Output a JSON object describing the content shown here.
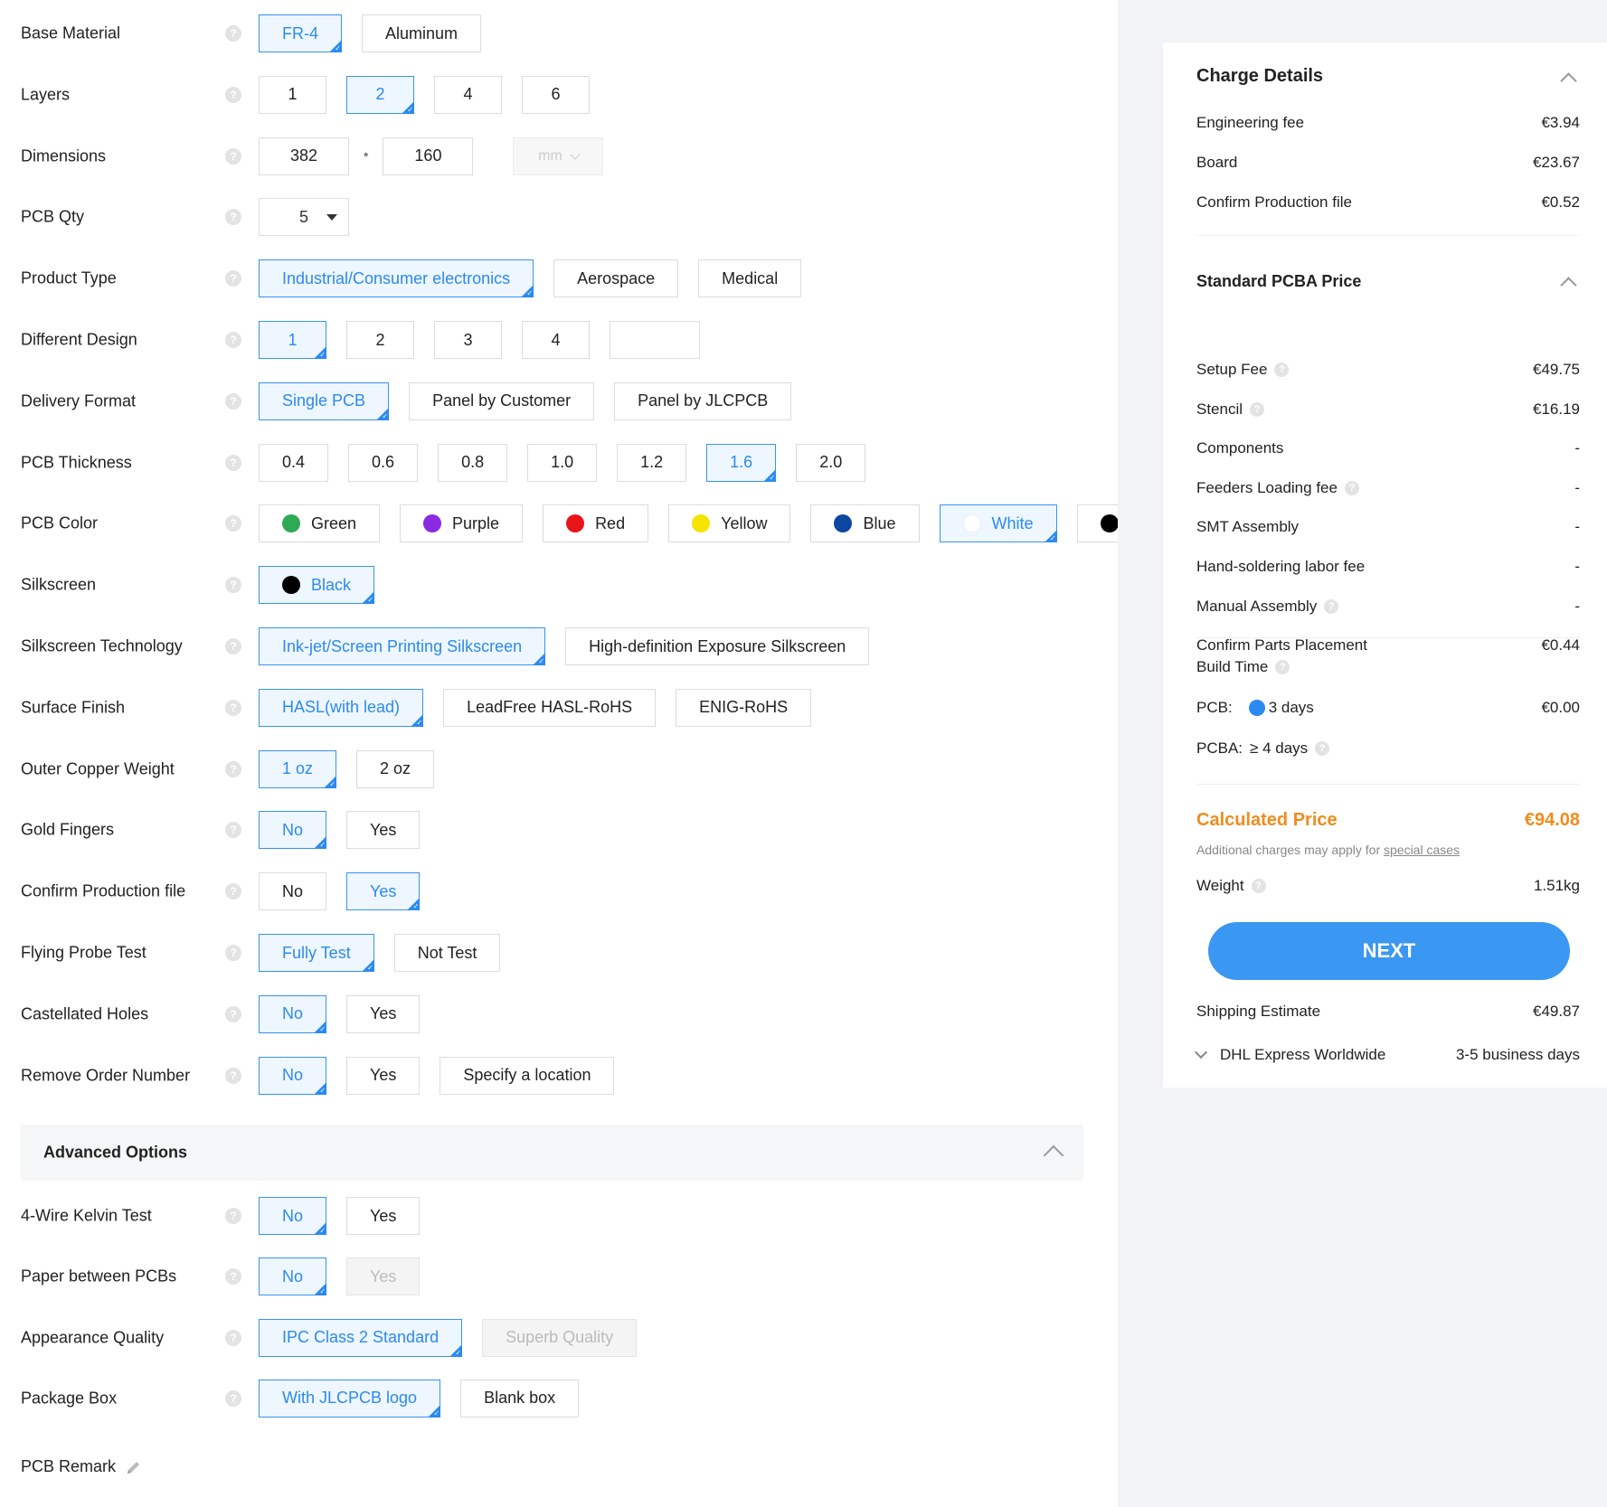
{
  "form": {
    "rows": [
      {
        "label": "Base Material",
        "options": [
          {
            "text": "FR-4",
            "state": "sel"
          },
          {
            "text": "Aluminum",
            "state": ""
          }
        ]
      },
      {
        "label": "Layers",
        "options": [
          {
            "text": "1",
            "state": ""
          },
          {
            "text": "2",
            "state": "sel"
          },
          {
            "text": "4",
            "state": ""
          },
          {
            "text": "6",
            "state": ""
          }
        ]
      },
      {
        "label": "Dimensions",
        "kind": "dims",
        "width": "382",
        "sep": "*",
        "height": "160",
        "unit": "mm"
      },
      {
        "label": "PCB Qty",
        "kind": "qty",
        "value": "5"
      },
      {
        "label": "Product Type",
        "options": [
          {
            "text": "Industrial/Consumer electronics",
            "state": "sel"
          },
          {
            "text": "Aerospace",
            "state": ""
          },
          {
            "text": "Medical",
            "state": ""
          }
        ]
      },
      {
        "label": "Different Design",
        "options": [
          {
            "text": "1",
            "state": "sel"
          },
          {
            "text": "2",
            "state": ""
          },
          {
            "text": "3",
            "state": ""
          },
          {
            "text": "4",
            "state": ""
          },
          {
            "text": "",
            "state": "blank"
          }
        ]
      },
      {
        "label": "Delivery Format",
        "options": [
          {
            "text": "Single PCB",
            "state": "sel"
          },
          {
            "text": "Panel by Customer",
            "state": ""
          },
          {
            "text": "Panel by JLCPCB",
            "state": ""
          }
        ]
      },
      {
        "label": "PCB Thickness",
        "options": [
          {
            "text": "0.4",
            "state": ""
          },
          {
            "text": "0.6",
            "state": ""
          },
          {
            "text": "0.8",
            "state": ""
          },
          {
            "text": "1.0",
            "state": ""
          },
          {
            "text": "1.2",
            "state": ""
          },
          {
            "text": "1.6",
            "state": "sel"
          },
          {
            "text": "2.0",
            "state": ""
          }
        ]
      },
      {
        "label": "PCB Color",
        "options": [
          {
            "text": "Green",
            "state": "",
            "color": "#2ea956"
          },
          {
            "text": "Purple",
            "state": "",
            "color": "#8a2be2"
          },
          {
            "text": "Red",
            "state": "",
            "color": "#e8141a"
          },
          {
            "text": "Yellow",
            "state": "",
            "color": "#f5e400"
          },
          {
            "text": "Blue",
            "state": "",
            "color": "#0d47a1"
          },
          {
            "text": "White",
            "state": "sel",
            "color": "#ffffff"
          },
          {
            "text": "Black",
            "state": "",
            "color": "#000000"
          }
        ]
      },
      {
        "label": "Silkscreen",
        "options": [
          {
            "text": "Black",
            "state": "sel",
            "color": "#000000"
          }
        ]
      },
      {
        "label": "Silkscreen Technology",
        "options": [
          {
            "text": "Ink-jet/Screen Printing Silkscreen",
            "state": "sel"
          },
          {
            "text": "High-definition Exposure Silkscreen",
            "state": ""
          }
        ]
      },
      {
        "label": "Surface Finish",
        "options": [
          {
            "text": "HASL(with lead)",
            "state": "sel"
          },
          {
            "text": "LeadFree HASL-RoHS",
            "state": ""
          },
          {
            "text": "ENIG-RoHS",
            "state": ""
          }
        ]
      },
      {
        "label": "Outer Copper Weight",
        "options": [
          {
            "text": "1 oz",
            "state": "sel"
          },
          {
            "text": "2 oz",
            "state": ""
          }
        ]
      },
      {
        "label": "Gold Fingers",
        "options": [
          {
            "text": "No",
            "state": "sel"
          },
          {
            "text": "Yes",
            "state": ""
          }
        ]
      },
      {
        "label": "Confirm Production file",
        "options": [
          {
            "text": "No",
            "state": ""
          },
          {
            "text": "Yes",
            "state": "sel"
          }
        ]
      },
      {
        "label": "Flying Probe Test",
        "options": [
          {
            "text": "Fully Test",
            "state": "sel"
          },
          {
            "text": "Not Test",
            "state": ""
          }
        ]
      },
      {
        "label": "Castellated Holes",
        "options": [
          {
            "text": "No",
            "state": "sel"
          },
          {
            "text": "Yes",
            "state": ""
          }
        ]
      },
      {
        "label": "Remove Order Number",
        "options": [
          {
            "text": "No",
            "state": "sel"
          },
          {
            "text": "Yes",
            "state": ""
          },
          {
            "text": "Specify a location",
            "state": ""
          }
        ]
      }
    ],
    "advanced_title": "Advanced Options",
    "advanced_rows": [
      {
        "label": "4-Wire Kelvin Test",
        "options": [
          {
            "text": "No",
            "state": "sel"
          },
          {
            "text": "Yes",
            "state": ""
          }
        ]
      },
      {
        "label": "Paper between PCBs",
        "options": [
          {
            "text": "No",
            "state": "sel"
          },
          {
            "text": "Yes",
            "state": "dis"
          }
        ]
      },
      {
        "label": "Appearance Quality",
        "options": [
          {
            "text": "IPC Class 2 Standard",
            "state": "sel"
          },
          {
            "text": "Superb Quality",
            "state": "dis"
          }
        ]
      },
      {
        "label": "Package Box",
        "options": [
          {
            "text": "With JLCPCB logo",
            "state": "sel"
          },
          {
            "text": "Blank box",
            "state": ""
          }
        ]
      }
    ],
    "remark_label": "PCB Remark",
    "help_glyph": "?"
  },
  "panel": {
    "charge_title": "Charge Details",
    "charges": [
      {
        "name": "Engineering fee",
        "value": "€3.94"
      },
      {
        "name": "Board",
        "value": "€23.67"
      },
      {
        "name": "Confirm Production file",
        "value": "€0.52"
      }
    ],
    "pcba_title": "Standard PCBA Price",
    "pcba": [
      {
        "name": "Setup Fee",
        "value": "€49.75",
        "help": true
      },
      {
        "name": "Stencil",
        "value": "€16.19",
        "help": true
      },
      {
        "name": "Components",
        "value": "-",
        "help": false
      },
      {
        "name": "Feeders Loading fee",
        "value": "-",
        "help": true
      },
      {
        "name": "SMT Assembly",
        "value": "-",
        "help": false
      },
      {
        "name": "Hand-soldering labor fee",
        "value": "-",
        "help": false
      },
      {
        "name": "Manual Assembly",
        "value": "-",
        "help": true
      },
      {
        "name": "Confirm Parts Placement",
        "value": "€0.44",
        "help": false
      }
    ],
    "build_time_label": "Build Time",
    "pcb_label": "PCB:",
    "pcb_days": "3 days",
    "pcb_price": "€0.00",
    "pcba_label": "PCBA:",
    "pcba_days": "≥ 4 days",
    "calc_label": "Calculated Price",
    "calc_value": "€94.08",
    "note_prefix": "Additional charges may apply for",
    "note_link": "special cases",
    "weight_label": "Weight",
    "weight_value": "1.51kg",
    "next_label": "NEXT",
    "shipping_label": "Shipping Estimate",
    "shipping_value": "€49.87",
    "carrier": "DHL Express Worldwide",
    "carrier_time": "3-5 business days",
    "accent": "#f08c1e",
    "primary": "#3a97f2"
  }
}
